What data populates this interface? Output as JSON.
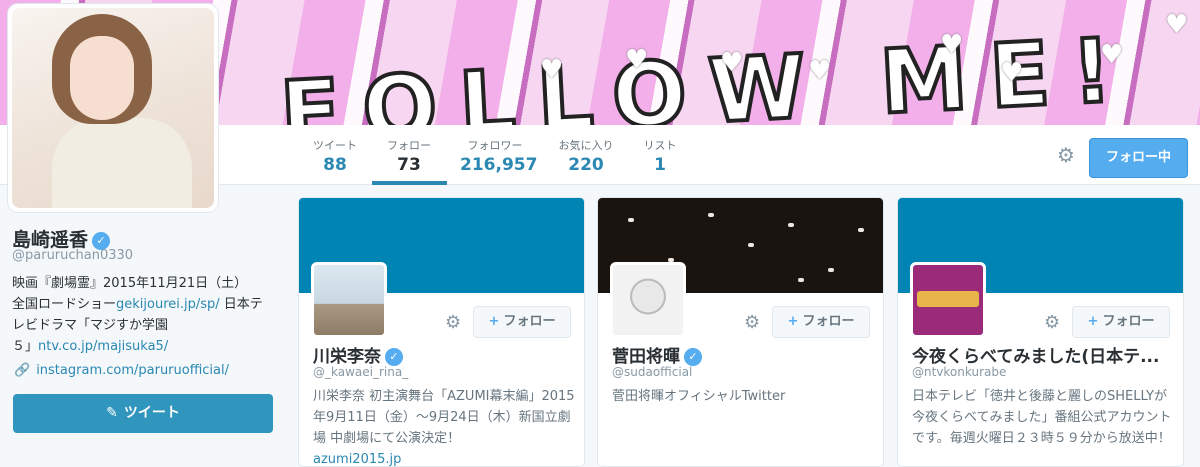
{
  "banner": {
    "text": "FOLLOW ME!"
  },
  "nav": {
    "items": [
      {
        "label": "ツイート",
        "value": "88"
      },
      {
        "label": "フォロー",
        "value": "73"
      },
      {
        "label": "フォロワー",
        "value": "216,957"
      },
      {
        "label": "お気に入り",
        "value": "220"
      },
      {
        "label": "リスト",
        "value": "1"
      }
    ],
    "follow_button": "フォロー中"
  },
  "profile": {
    "name": "島崎遥香",
    "handle": "@paruruchan0330",
    "bio_line1": "映画『劇場霊』2015年11月21日（土）",
    "bio_line2_pre": "全国ロードショー",
    "bio_link1": "gekijourei.jp/sp/",
    "bio_line2_post": " 日本テ",
    "bio_line3": "レビドラマ「マジすか学園",
    "bio_line4_pre": "５」",
    "bio_link2": "ntv.co.jp/majisuka5/",
    "website": "instagram.com/paruruofficial/",
    "tweet_button": "ツイート"
  },
  "cards": [
    {
      "name": "川栄李奈",
      "handle": "@_kawaei_rina_",
      "verified": true,
      "bio": "川栄李奈 初主演舞台「AZUMI幕末編」2015年9月11日（金）～9月24日（木）新国立劇場 中劇場にて公演決定！",
      "bio_link": "azumi2015.jp",
      "follow_label": "フォロー"
    },
    {
      "name": "菅田将暉",
      "handle": "@sudaofficial",
      "verified": true,
      "bio": "菅田将暉オフィシャルTwitter",
      "bio_link": "",
      "follow_label": "フォロー"
    },
    {
      "name": "今夜くらべてみました(日本テ...",
      "handle": "@ntvkonkurabe",
      "verified": false,
      "bio": "日本テレビ「徳井と後藤と麗しのSHELLYが今夜くらべてみました」番組公式アカウントです。毎週火曜日２３時５９分から放送中！",
      "bio_link": "",
      "follow_label": "フォロー"
    }
  ],
  "colors": {
    "accent": "#2a88b2",
    "follow_blue": "#55acee",
    "card_banner": "#0084b4"
  }
}
